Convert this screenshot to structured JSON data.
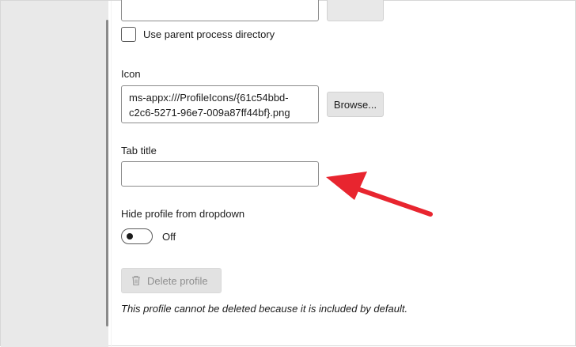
{
  "settings": {
    "starting_dir": {
      "browse_label": ""
    },
    "parent_dir_checkbox_label": "Use parent process directory",
    "icon": {
      "label": "Icon",
      "value": "ms-appx:///ProfileIcons/{61c54bbd-c2c6-5271-96e7-009a87ff44bf}.png",
      "browse_label": "Browse..."
    },
    "tab_title": {
      "label": "Tab title",
      "value": ""
    },
    "hide_profile": {
      "label": "Hide profile from dropdown",
      "state_label": "Off"
    },
    "delete": {
      "label": "Delete profile",
      "note": "This profile cannot be deleted because it is included by default."
    }
  },
  "annotation": {
    "arrow_color": "#e8252f"
  },
  "icons": [
    "trash-icon"
  ]
}
